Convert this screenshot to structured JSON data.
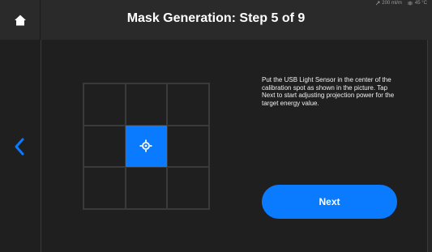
{
  "header": {
    "title": "Mask Generation: Step 5 of 9",
    "home_icon": "home-icon"
  },
  "status": {
    "flow": "200 ml/m",
    "temperature": "45 °C"
  },
  "instructions": "Put the USB Light Sensor in the center of the calibration spot as shown in the picture. Tap Next to start adjusting projection power for the target energy value.",
  "buttons": {
    "next_label": "Next"
  },
  "colors": {
    "accent": "#0a7bff",
    "background": "#1f1f1f",
    "header": "#2a2a2a"
  },
  "calibration_grid": {
    "rows": 3,
    "columns": 3,
    "active_cell": "center"
  }
}
